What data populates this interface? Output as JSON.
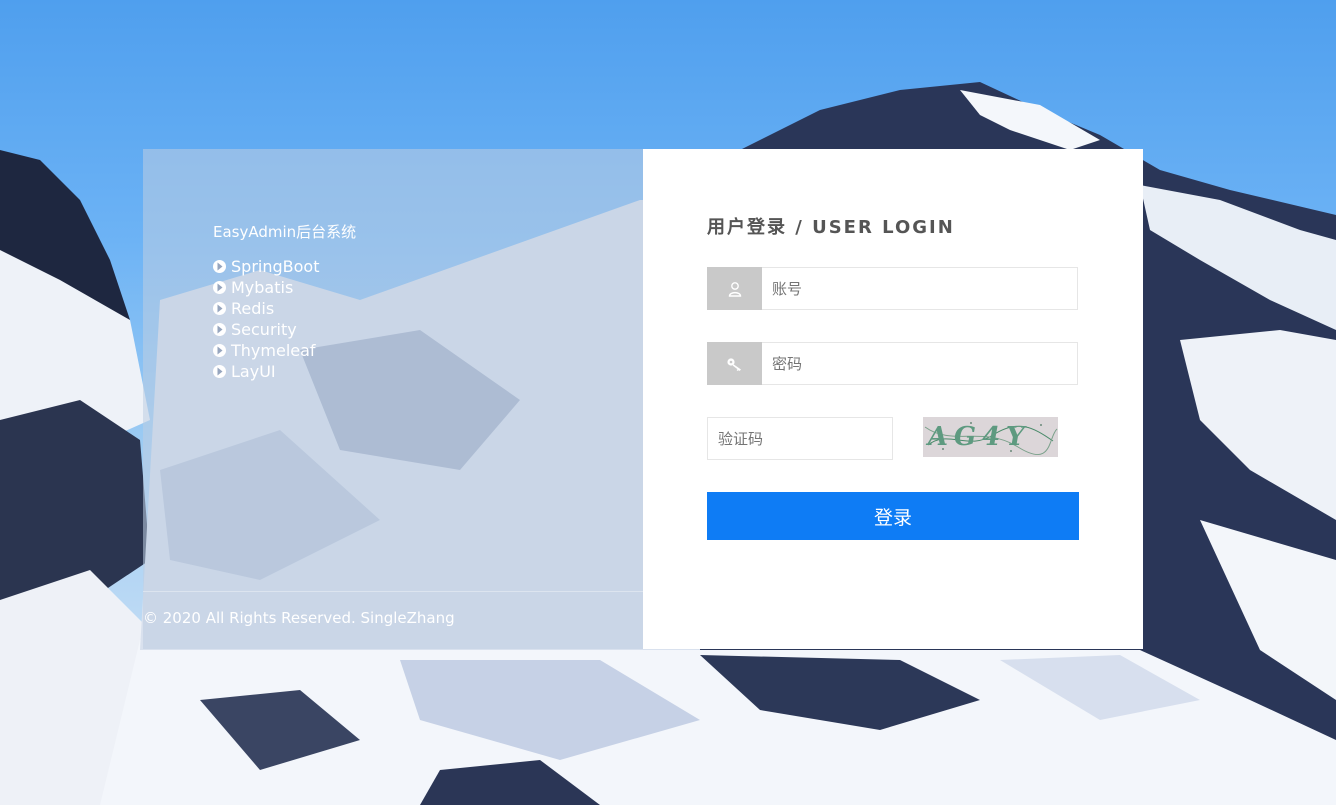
{
  "brand": {
    "name": "EasyAdmin后台系统"
  },
  "tech_list": [
    "SpringBoot",
    "Mybatis",
    "Redis",
    "Security",
    "Thymeleaf",
    "LayUI"
  ],
  "footer": {
    "copyright": "© 2020 All Rights Reserved. SingleZhang"
  },
  "login": {
    "title": "用户登录 / USER LOGIN",
    "username_placeholder": "账号",
    "password_placeholder": "密码",
    "captcha_placeholder": "验证码",
    "captcha_text": "AG4Y",
    "submit_label": "登录"
  },
  "icons": {
    "username": "user-icon",
    "password": "key-icon",
    "tech_bullet": "arrow-circle-icon"
  },
  "colors": {
    "primary_button": "#0e7cf5",
    "icon_box": "#c9c9c9",
    "title_text": "#555555"
  }
}
